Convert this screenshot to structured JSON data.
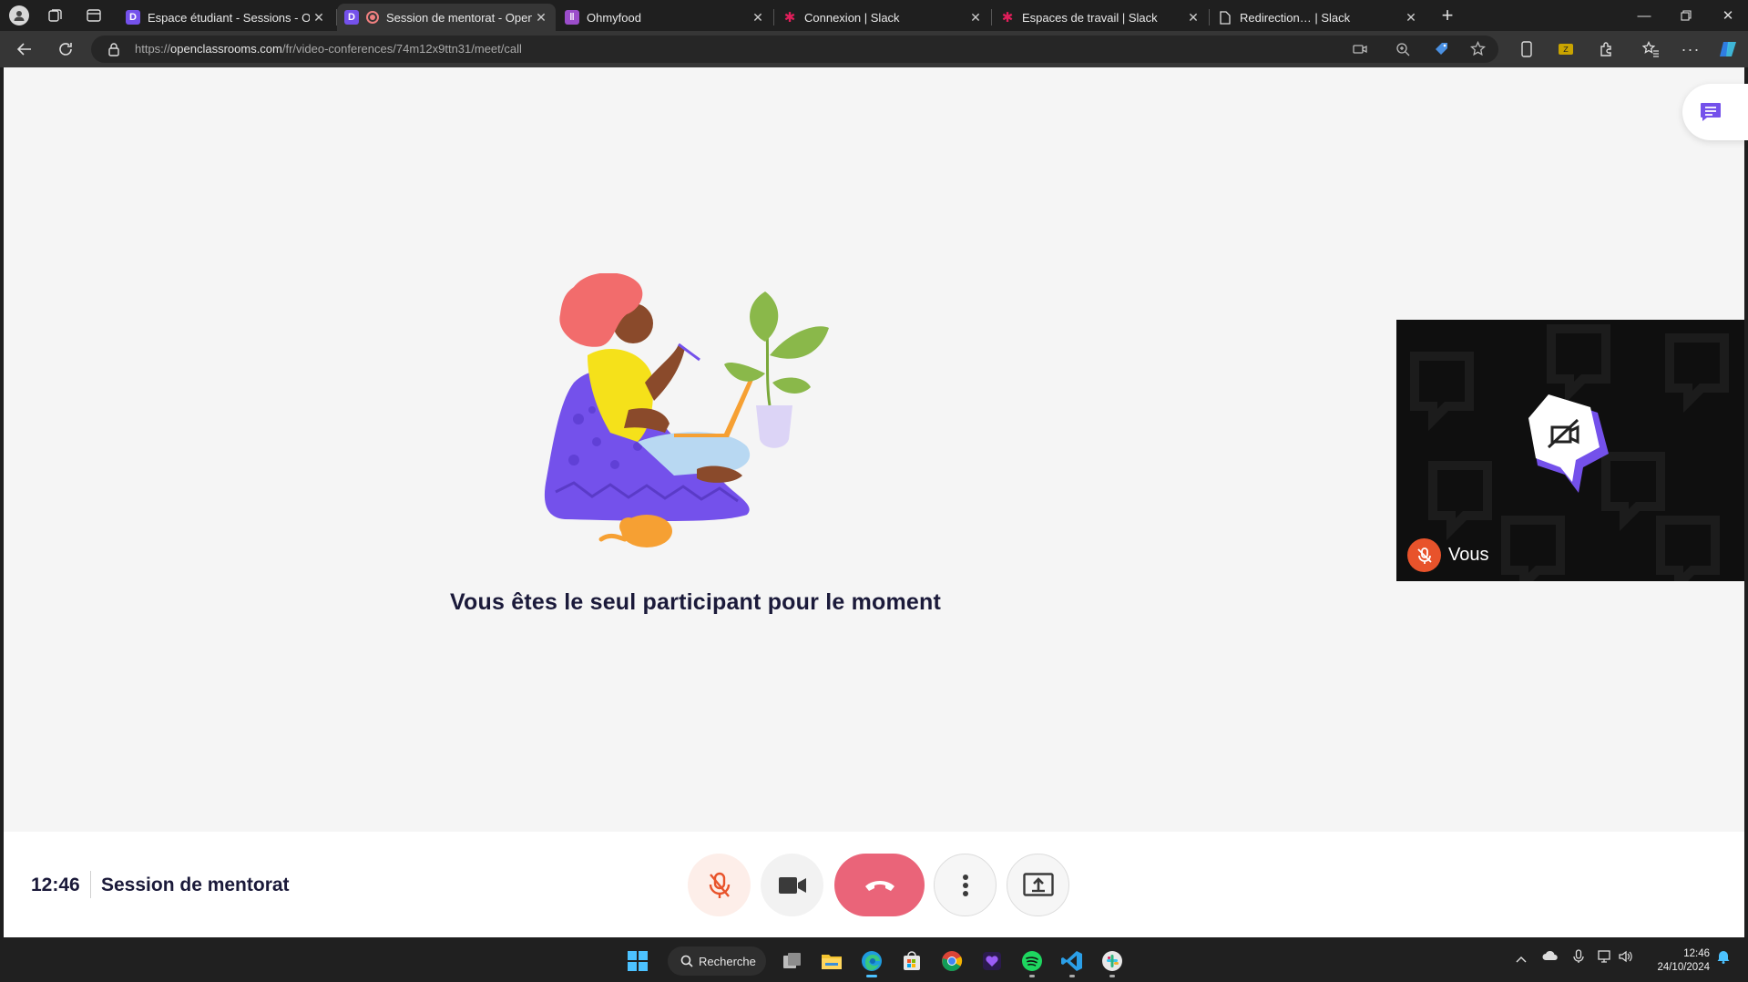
{
  "browser": {
    "tabs": [
      {
        "title": "Espace étudiant - Sessions - Oper",
        "favicon": "openclassrooms-icon",
        "active": false
      },
      {
        "title": "Session de mentorat - Openc",
        "favicon": "openclassrooms-icon",
        "active": true,
        "recording": true
      },
      {
        "title": "Ohmyfood",
        "favicon": "ohmyfood-icon",
        "active": false
      },
      {
        "title": "Connexion | Slack",
        "favicon": "slack-icon",
        "active": false
      },
      {
        "title": "Espaces de travail | Slack",
        "favicon": "slack-icon",
        "active": false
      },
      {
        "title": "Redirection… | Slack",
        "favicon": "page-icon",
        "active": false
      }
    ],
    "url_prefix": "https://",
    "url_host": "openclassrooms.com",
    "url_path": "/fr/video-conferences/74m12x9ttn31/meet/call"
  },
  "meeting": {
    "empty_message": "Vous êtes le seul participant pour le moment",
    "self_label": "Vous",
    "time": "12:46",
    "title": "Session de mentorat"
  },
  "taskbar": {
    "search_label": "Recherche",
    "time": "12:46",
    "date": "24/10/2024"
  },
  "colors": {
    "accent_purple": "#7451eb",
    "hangup": "#ea6479",
    "muted": "#e8532b"
  }
}
